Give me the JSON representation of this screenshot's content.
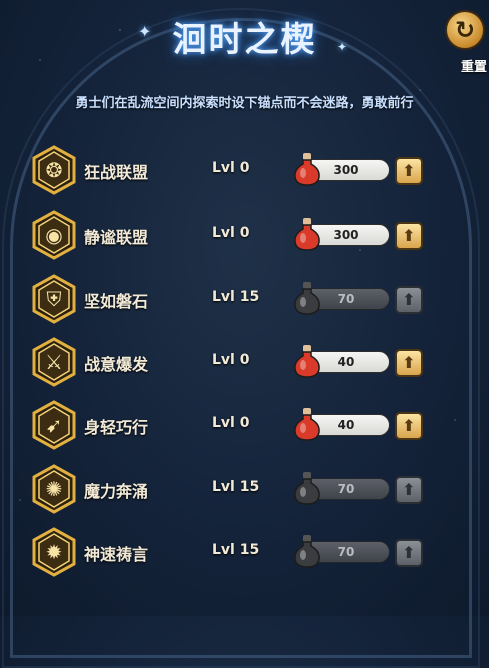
{
  "header": {
    "title": "洄时之楔",
    "reset_label": "重置",
    "subtitle": "勇士们在乱流空间内探索时设下锚点而不会迷路，勇敢前行"
  },
  "skills": [
    {
      "name": "狂战联盟",
      "level": "Lvl 0",
      "cost": "300",
      "enabled": true,
      "icon": "claw-emblem-icon"
    },
    {
      "name": "静谧联盟",
      "level": "Lvl 0",
      "cost": "300",
      "enabled": true,
      "icon": "eye-emblem-icon"
    },
    {
      "name": "坚如磐石",
      "level": "Lvl 15",
      "cost": "70",
      "enabled": false,
      "icon": "shield-icon"
    },
    {
      "name": "战意爆发",
      "level": "Lvl 0",
      "cost": "40",
      "enabled": true,
      "icon": "winged-axe-icon"
    },
    {
      "name": "身轻巧行",
      "level": "Lvl 0",
      "cost": "40",
      "enabled": true,
      "icon": "dash-icon"
    },
    {
      "name": "魔力奔涌",
      "level": "Lvl 15",
      "cost": "70",
      "enabled": false,
      "icon": "magic-orb-icon"
    },
    {
      "name": "神速祷言",
      "level": "Lvl 15",
      "cost": "70",
      "enabled": false,
      "icon": "radiant-flame-icon"
    }
  ],
  "colors": {
    "title_glow": "#58a8ff",
    "badge_gold": "#e2b040",
    "potion_red": "#d93a2a",
    "potion_gray": "#3a3c40",
    "upgrade_gold": "#d9a54d"
  }
}
